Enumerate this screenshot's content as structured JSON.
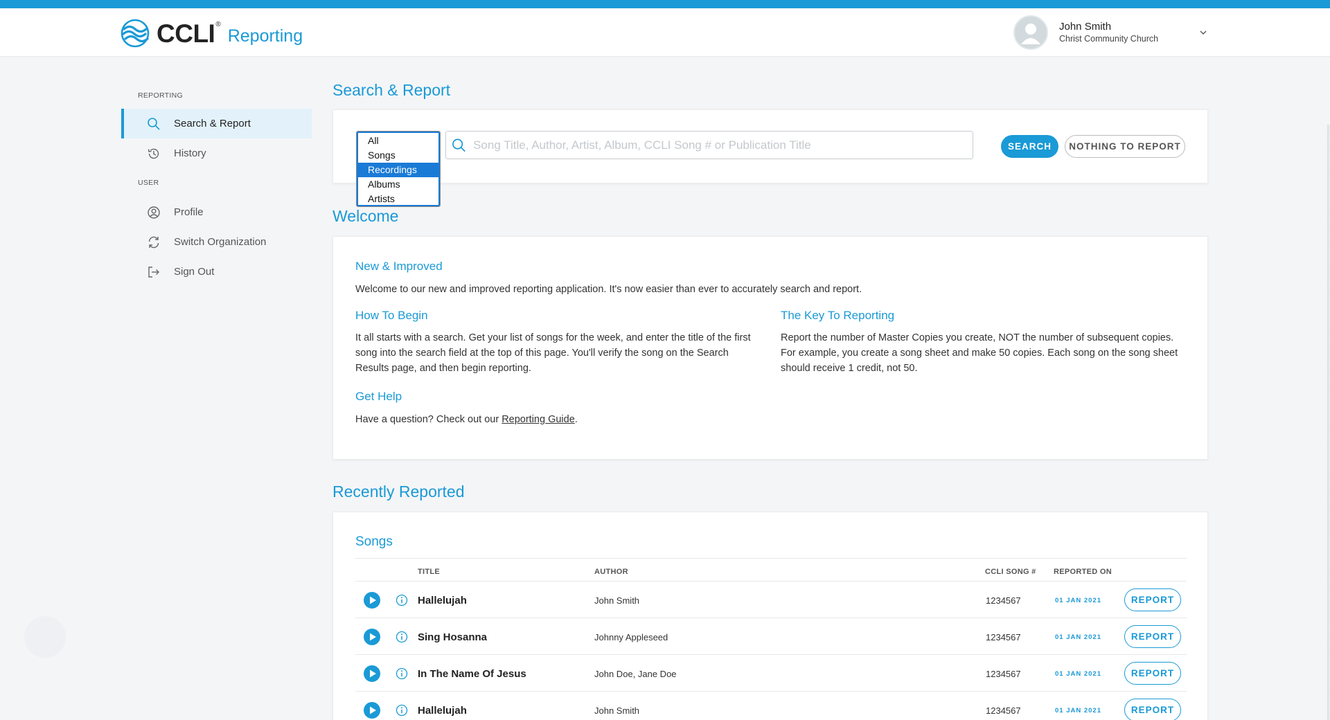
{
  "brand": {
    "logo_text": "CCLI",
    "logo_reg": "®",
    "app_name": "Reporting"
  },
  "user": {
    "name": "John Smith",
    "organization": "Christ Community Church"
  },
  "sidebar": {
    "reporting_heading": "REPORTING",
    "user_heading": "USER",
    "items": [
      {
        "label": "Search & Report"
      },
      {
        "label": "History"
      },
      {
        "label": "Profile"
      },
      {
        "label": "Switch Organization"
      },
      {
        "label": "Sign Out"
      }
    ]
  },
  "search": {
    "section_title": "Search & Report",
    "type_options": [
      "All",
      "Songs",
      "Recordings",
      "Albums",
      "Artists"
    ],
    "selected_option": "Recordings",
    "placeholder": "Song Title, Author, Artist, Album, CCLI Song # or Publication Title",
    "value": "",
    "search_button": "SEARCH",
    "nothing_button": "NOTHING TO REPORT"
  },
  "welcome": {
    "section_title": "Welcome",
    "new_heading": "New & Improved",
    "new_text": "Welcome to our new and improved reporting application. It's now easier than ever to accurately search and report.",
    "begin_heading": "How To Begin",
    "begin_text": "It all starts with a search. Get your list of songs for the week, and enter the title of the first song into the search field at the top of this page. You'll verify the song on the Search Results page, and then begin reporting.",
    "key_heading": "The Key To Reporting",
    "key_text": "Report the number of Master Copies you create, NOT the number of subsequent copies. For example, you create a song sheet and make 50 copies. Each song on the song sheet should receive 1 credit, not 50.",
    "help_heading": "Get Help",
    "help_text_before": "Have a question? Check out our ",
    "help_link": "Reporting Guide",
    "help_text_after": "."
  },
  "recent": {
    "section_title": "Recently Reported",
    "songs_title": "Songs",
    "columns": {
      "title": "TITLE",
      "author": "AUTHOR",
      "song_num": "CCLI SONG #",
      "reported_on": "REPORTED ON"
    },
    "report_label": "REPORT",
    "rows": [
      {
        "title": "Hallelujah",
        "author": "John Smith",
        "song_num": "1234567",
        "date": "01 JAN 2021"
      },
      {
        "title": "Sing Hosanna",
        "author": "Johnny Appleseed",
        "song_num": "1234567",
        "date": "01 JAN 2021"
      },
      {
        "title": "In The Name Of Jesus",
        "author": "John Doe, Jane Doe",
        "song_num": "1234567",
        "date": "01 JAN 2021"
      },
      {
        "title": "Hallelujah",
        "author": "John Smith",
        "song_num": "1234567",
        "date": "01 JAN 2021"
      }
    ]
  },
  "colors": {
    "accent": "#1a9ad6",
    "selection": "#1a7bd6",
    "active_nav_bg": "#e3f2fa"
  },
  "icons": {
    "logo": "ccli-wave-icon",
    "nav": [
      "search-icon",
      "history-icon",
      "profile-icon",
      "switch-icon",
      "sign-out-icon"
    ],
    "row_play": "play-icon",
    "row_info": "info-icon"
  }
}
